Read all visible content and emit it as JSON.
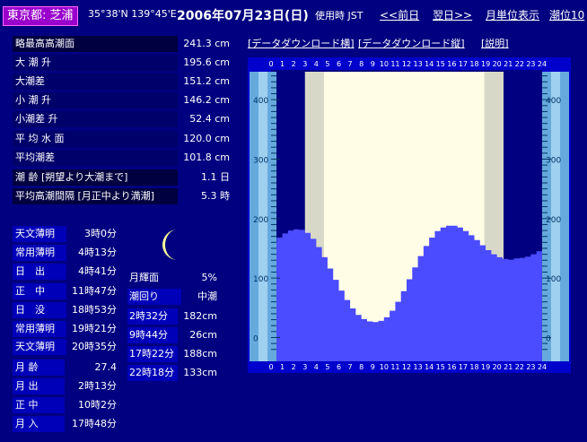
{
  "header": {
    "location": "東京都: 芝浦",
    "coords": "35°38'N 139°45'E",
    "date": "2006年07月23日(日)",
    "timezone": "使用時 JST",
    "prev_day": "<<前日",
    "next_day": "翌日>>",
    "monthly_view": "月単位表示",
    "tide_level": "潮位10"
  },
  "tide_info": [
    {
      "label": "略最高高潮面",
      "value": "241.3 cm"
    },
    {
      "label": "大 潮 升",
      "value": "195.6 cm"
    },
    {
      "label": "大潮差",
      "value": "151.2 cm"
    },
    {
      "label": "小 潮 升",
      "value": "146.2 cm"
    },
    {
      "label": "小潮差 升",
      "value": "52.4 cm"
    },
    {
      "label": "平 均 水 面",
      "value": "120.0 cm"
    },
    {
      "label": "平均潮差",
      "value": "101.8 cm"
    },
    {
      "label": "潮 齢 [朔望より大潮まで]",
      "value": "1.1 日"
    },
    {
      "label": "平均高潮間隔 [月正中より満潮]",
      "value": "5.3 時"
    }
  ],
  "sun": [
    {
      "label": "天文薄明",
      "value": "3時0分"
    },
    {
      "label": "常用薄明",
      "value": "4時13分"
    },
    {
      "label": "日　出",
      "value": "4時41分"
    },
    {
      "label": "正　中",
      "value": "11時47分"
    },
    {
      "label": "日　没",
      "value": "18時53分"
    },
    {
      "label": "常用薄明",
      "value": "19時21分"
    },
    {
      "label": "天文薄明",
      "value": "20時35分"
    }
  ],
  "moon_times": [
    {
      "label": "月 齢",
      "value": "27.4"
    },
    {
      "label": "月 出",
      "value": "2時13分"
    },
    {
      "label": "正 中",
      "value": "10時2分"
    },
    {
      "label": "月 入",
      "value": "17時48分"
    }
  ],
  "moon": {
    "brightness_label": "月輝面",
    "brightness_value": "5%",
    "tide_label": "潮回り",
    "tide_value": "中潮"
  },
  "tides": [
    {
      "time": "2時32分",
      "height": "182cm"
    },
    {
      "time": "9時44分",
      "height": "26cm"
    },
    {
      "time": "17時22分",
      "height": "188cm"
    },
    {
      "time": "22時18分",
      "height": "133cm"
    }
  ],
  "links": {
    "download_h": "[データダウンロード横]",
    "download_v": "[データダウンロード縦]",
    "help": "[説明]"
  },
  "icons": {
    "moon": "crescent-moon-icon"
  },
  "colors": {
    "background": "#000080",
    "tide_fill": "#4b4bff",
    "daylight": "#fffde6",
    "twilight": "#d8d8c8",
    "ruler": "#66aadd",
    "location_badge": "#9900cc"
  },
  "chart_data": {
    "type": "area",
    "x": [
      0,
      0.5,
      1,
      1.5,
      2,
      2.5,
      3,
      3.5,
      4,
      4.5,
      5,
      5.5,
      6,
      6.5,
      7,
      7.5,
      8,
      8.5,
      9,
      9.5,
      10,
      10.5,
      11,
      11.5,
      12,
      12.5,
      13,
      13.5,
      14,
      14.5,
      15,
      15.5,
      16,
      16.5,
      17,
      17.5,
      18,
      18.5,
      19,
      19.5,
      20,
      20.5,
      21,
      21.5,
      22,
      22.5,
      23,
      23.5,
      24
    ],
    "values": [
      160,
      168,
      175,
      180,
      182,
      181,
      176,
      166,
      152,
      135,
      116,
      97,
      79,
      63,
      49,
      38,
      31,
      27,
      26,
      28,
      34,
      45,
      60,
      78,
      98,
      118,
      137,
      154,
      168,
      179,
      185,
      188,
      188,
      185,
      179,
      172,
      164,
      155,
      147,
      140,
      135,
      132,
      131,
      133,
      134,
      136,
      140,
      145,
      150
    ],
    "x_ticks": [
      "0",
      "1",
      "2",
      "3",
      "4",
      "5",
      "6",
      "7",
      "8",
      "9",
      "10",
      "11",
      "12",
      "13",
      "14",
      "15",
      "16",
      "17",
      "18",
      "19",
      "20",
      "21",
      "22",
      "23",
      "24"
    ],
    "y_ticks": [
      "0",
      "100",
      "200",
      "300",
      "400"
    ],
    "ylim": [
      -40,
      450
    ],
    "xlim": [
      0,
      24
    ],
    "shading": {
      "astronomical_twilight_start": 3.0,
      "sunrise": 4.683,
      "sunset": 18.883,
      "astronomical_twilight_end": 20.583
    }
  }
}
